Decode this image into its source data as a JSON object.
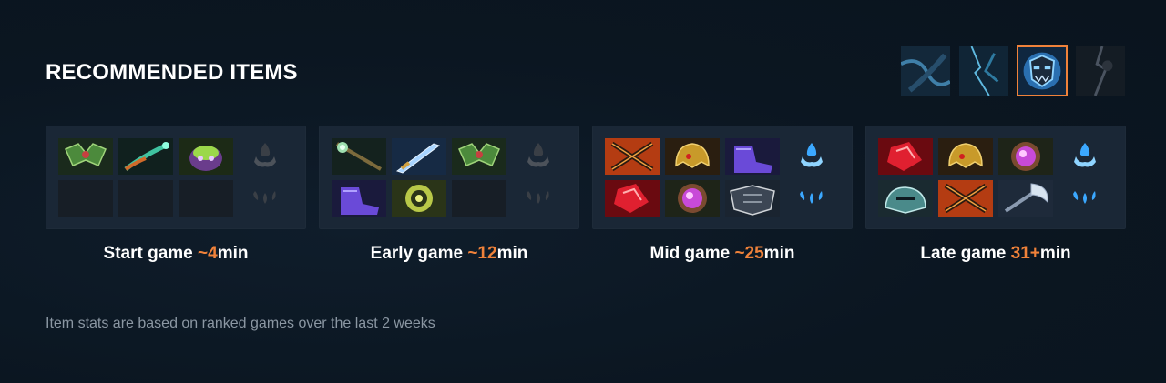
{
  "title": "RECOMMENDED ITEMS",
  "hero_tabs": [
    {
      "name": "hero-variant-1",
      "active": false
    },
    {
      "name": "hero-variant-2",
      "active": false
    },
    {
      "name": "hero-variant-3",
      "active": true
    },
    {
      "name": "hero-variant-4",
      "active": false
    }
  ],
  "stages": [
    {
      "prefix": "Start game ",
      "time": "~4",
      "suffix": "min",
      "items": [
        "green-helm-item",
        "glowing-wand-item",
        "purple-mask-item",
        "empty-slot",
        "empty-slot",
        "empty-slot"
      ],
      "neutral_active": false
    },
    {
      "prefix": "Early game ",
      "time": "~12",
      "suffix": "min",
      "items": [
        "green-staff-item",
        "blue-sword-item",
        "green-helm-item",
        "purple-boots-item",
        "yellow-orb-item",
        "empty-slot"
      ],
      "neutral_active": false
    },
    {
      "prefix": "Mid game ",
      "time": "~25",
      "suffix": "min",
      "items": [
        "crossed-blades-item",
        "gold-helm-item",
        "purple-boots-item",
        "red-gem-item",
        "pink-orb-item",
        "dark-shield-item"
      ],
      "neutral_active": true
    },
    {
      "prefix": "Late game ",
      "time": "31+",
      "suffix": "min",
      "items": [
        "red-gem-item",
        "gold-helm-item",
        "pink-orb-item",
        "teal-helm-item",
        "crossed-blades-item",
        "silver-axe-item"
      ],
      "neutral_active": true
    }
  ],
  "colors": {
    "accent": "#f0823a",
    "panel": "#1a2736",
    "background": "#0b1621",
    "muted_text": "#8b97a3",
    "neutral_active": "#3ba8ff"
  },
  "footnote": "Item stats are based on ranked games over the last 2 weeks"
}
